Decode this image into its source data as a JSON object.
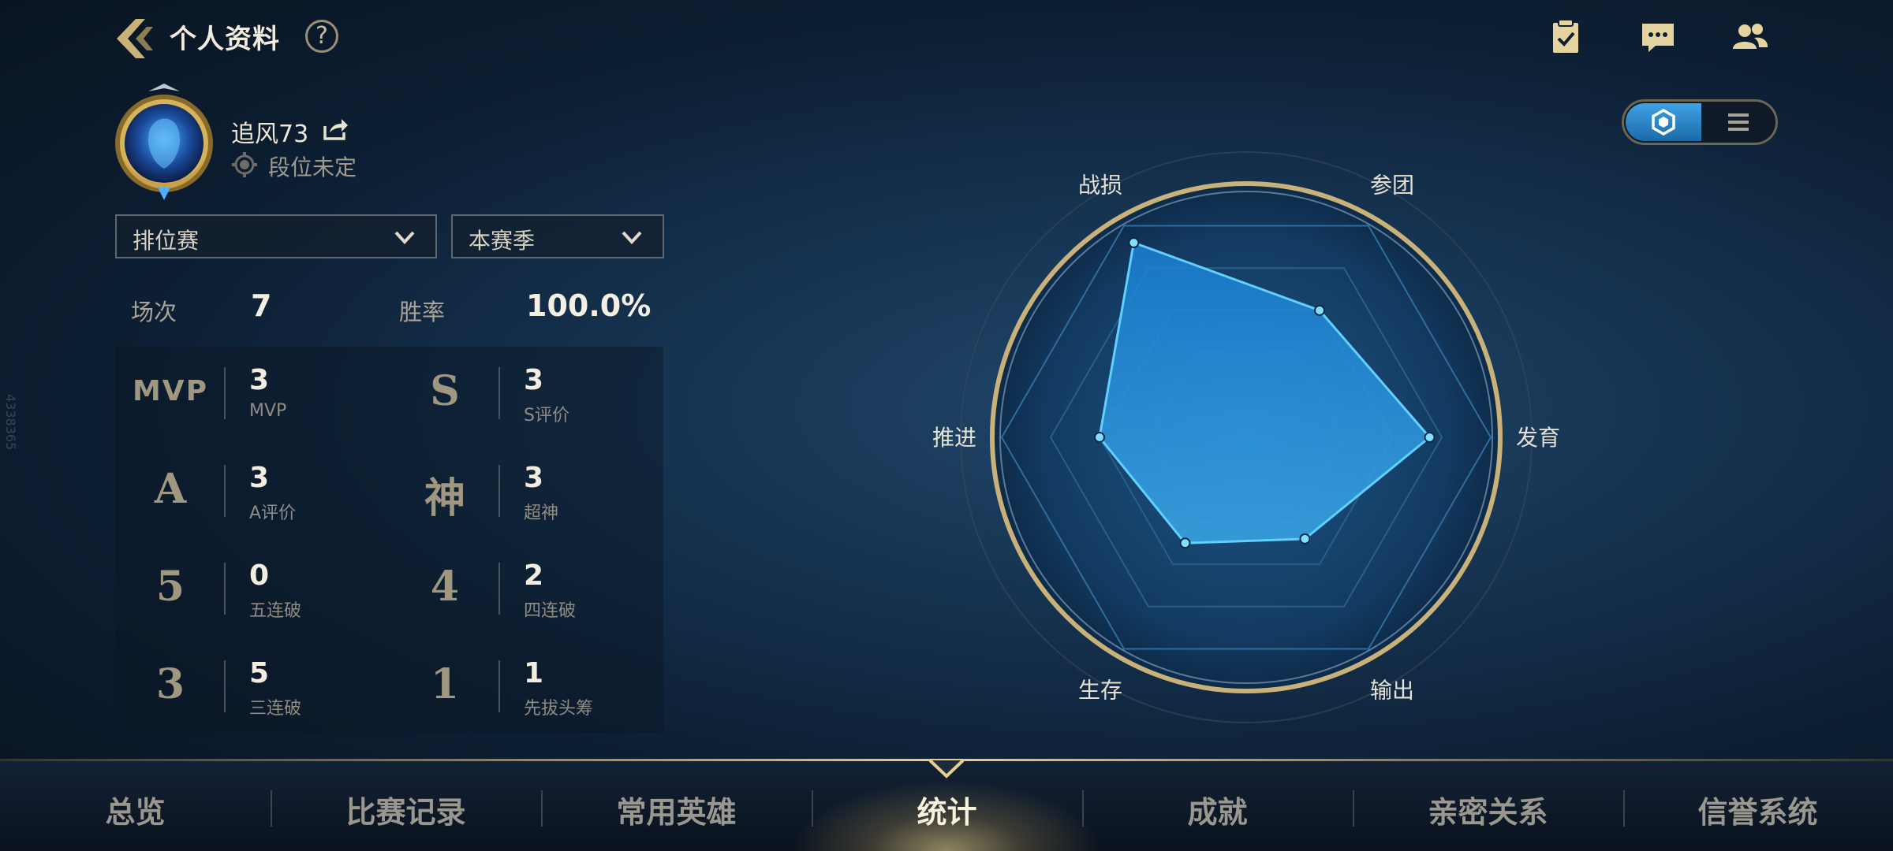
{
  "header": {
    "title": "个人资料",
    "help_label": "?",
    "icons": [
      "checklist-icon",
      "chat-icon",
      "friends-icon"
    ]
  },
  "profile": {
    "name": "追风73",
    "rank_text": "段位未定"
  },
  "filters": {
    "mode": "排位赛",
    "season": "本赛季"
  },
  "summary": {
    "games_label": "场次",
    "games_value": "7",
    "winrate_label": "胜率",
    "winrate_value": "100.0%"
  },
  "stats": [
    {
      "badge": "MVP",
      "value": "3",
      "label": "MVP"
    },
    {
      "badge": "S",
      "value": "3",
      "label": "S评价"
    },
    {
      "badge": "A",
      "value": "3",
      "label": "A评价"
    },
    {
      "badge": "神",
      "value": "3",
      "label": "超神"
    },
    {
      "badge": "5",
      "value": "0",
      "label": "五连破"
    },
    {
      "badge": "4",
      "value": "2",
      "label": "四连破"
    },
    {
      "badge": "3",
      "value": "5",
      "label": "三连破"
    },
    {
      "badge": "1",
      "value": "1",
      "label": "先拔头筹"
    }
  ],
  "radar": {
    "axes": [
      "战损",
      "参团",
      "发育",
      "输出",
      "生存",
      "推进"
    ],
    "values": [
      0.92,
      0.6,
      0.75,
      0.48,
      0.5,
      0.6
    ]
  },
  "watermark": "4338365",
  "nav": {
    "tabs": [
      "总览",
      "比赛记录",
      "常用英雄",
      "统计",
      "成就",
      "亲密关系",
      "信誉系统"
    ],
    "active_index": 3
  },
  "colors": {
    "accent": "#3fb6f2",
    "gold": "#c9b27a"
  }
}
